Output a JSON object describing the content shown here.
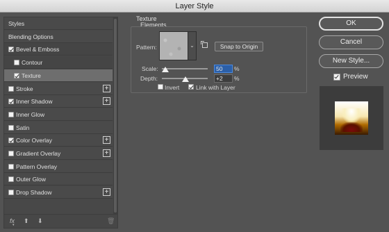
{
  "window": {
    "title": "Layer Style"
  },
  "styles_list": {
    "items": [
      {
        "label": "Styles",
        "checkbox": false,
        "checked": false,
        "plus": false,
        "indent": 0,
        "kind": "header"
      },
      {
        "label": "Blending Options",
        "checkbox": false,
        "checked": false,
        "plus": false,
        "indent": 0,
        "kind": "header"
      },
      {
        "label": "Bevel & Emboss",
        "checkbox": true,
        "checked": true,
        "plus": false,
        "indent": 0,
        "kind": "active-parent"
      },
      {
        "label": "Contour",
        "checkbox": true,
        "checked": false,
        "plus": false,
        "indent": 1,
        "kind": "active-parent"
      },
      {
        "label": "Texture",
        "checkbox": true,
        "checked": true,
        "plus": false,
        "indent": 1,
        "kind": "selected"
      },
      {
        "label": "Stroke",
        "checkbox": true,
        "checked": false,
        "plus": true,
        "indent": 0,
        "kind": "normal"
      },
      {
        "label": "Inner Shadow",
        "checkbox": true,
        "checked": true,
        "plus": true,
        "indent": 0,
        "kind": "normal"
      },
      {
        "label": "Inner Glow",
        "checkbox": true,
        "checked": false,
        "plus": false,
        "indent": 0,
        "kind": "normal"
      },
      {
        "label": "Satin",
        "checkbox": true,
        "checked": false,
        "plus": false,
        "indent": 0,
        "kind": "normal"
      },
      {
        "label": "Color Overlay",
        "checkbox": true,
        "checked": true,
        "plus": true,
        "indent": 0,
        "kind": "normal"
      },
      {
        "label": "Gradient Overlay",
        "checkbox": true,
        "checked": false,
        "plus": true,
        "indent": 0,
        "kind": "normal"
      },
      {
        "label": "Pattern Overlay",
        "checkbox": true,
        "checked": false,
        "plus": false,
        "indent": 0,
        "kind": "normal"
      },
      {
        "label": "Outer Glow",
        "checkbox": true,
        "checked": false,
        "plus": false,
        "indent": 0,
        "kind": "normal"
      },
      {
        "label": "Drop Shadow",
        "checkbox": true,
        "checked": false,
        "plus": true,
        "indent": 0,
        "kind": "normal"
      }
    ],
    "bottom_icons": [
      "fx-icon",
      "arrow-up-icon",
      "arrow-down-icon",
      "trash-icon"
    ],
    "fx_label": "fx"
  },
  "texture": {
    "section_title": "Texture",
    "group_title": "Elements",
    "pattern_label": "Pattern:",
    "snap_button": "Snap to Origin",
    "scale_label": "Scale:",
    "scale_value": "50",
    "scale_unit": "%",
    "scale_fraction": 0.07,
    "depth_label": "Depth:",
    "depth_value": "+2",
    "depth_unit": "%",
    "depth_fraction": 0.51,
    "invert_label": "Invert",
    "invert_checked": false,
    "link_label": "Link with Layer",
    "link_checked": true
  },
  "actions": {
    "ok": "OK",
    "cancel": "Cancel",
    "new_style": "New Style...",
    "preview_label": "Preview",
    "preview_checked": true
  }
}
